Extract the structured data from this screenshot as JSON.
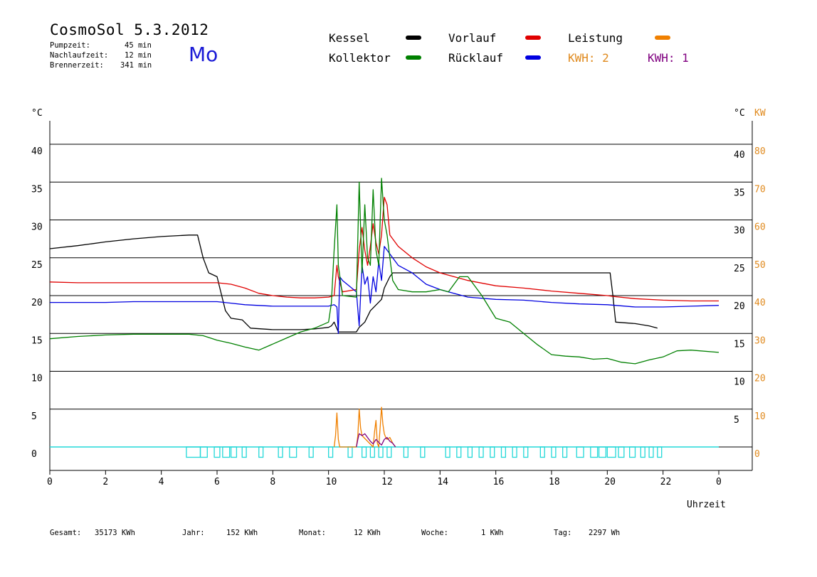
{
  "header": {
    "title": "CosmoSol 5.3.2012",
    "pumpzeit_label": "Pumpzeit:",
    "pumpzeit_value": "45 min",
    "nachlaufzeit_label": "Nachlaufzeit:",
    "nachlaufzeit_value": "12 min",
    "brennerzeit_label": "Brennerzeit:",
    "brennerzeit_value": "341 min",
    "weekday": "Mo"
  },
  "legend": {
    "kessel": {
      "label": "Kessel",
      "color": "#000000"
    },
    "kollektor": {
      "label": "Kollektor",
      "color": "#008000"
    },
    "vorlauf": {
      "label": "Vorlauf",
      "color": "#e00000"
    },
    "ruecklauf": {
      "label": "Rücklauf",
      "color": "#0000e0"
    },
    "leistung": {
      "label": "Leistung",
      "color": "#f08000"
    },
    "kwh2": {
      "label": "KWH: 2",
      "color": "#e08a1e"
    },
    "kwh1": {
      "label": "KWH: 1",
      "color": "#800080"
    }
  },
  "footer": {
    "gesamt_label": "Gesamt:",
    "gesamt_value": "35173 KWh",
    "jahr_label": "Jahr:",
    "jahr_value": "152 KWh",
    "monat_label": "Monat:",
    "monat_value": "12 KWh",
    "woche_label": "Woche:",
    "woche_value": "1 KWh",
    "tag_label": "Tag:",
    "tag_value": "2297 Wh"
  },
  "chart_data": {
    "type": "line",
    "xlabel": "Uhrzeit",
    "ylabel_left": "°C",
    "ylabel_right_1": "°C",
    "ylabel_right_2": "KW",
    "xlim": [
      0,
      24
    ],
    "ylim": [
      -3,
      43
    ],
    "x_ticks": [
      0,
      2,
      4,
      6,
      8,
      10,
      12,
      14,
      16,
      18,
      20,
      22,
      24
    ],
    "x_tick_labels": [
      "0",
      "2",
      "4",
      "6",
      "8",
      "10",
      "12",
      "14",
      "16",
      "18",
      "20",
      "22",
      "0"
    ],
    "y_ticks": [
      0,
      5,
      10,
      15,
      20,
      25,
      30,
      35,
      40
    ],
    "y_tick_labels_left": [
      "0",
      "5",
      "10",
      "15",
      "20",
      "25",
      "30",
      "35",
      "40"
    ],
    "y_tick_labels_right": [
      "",
      "5",
      "10",
      "15",
      "20",
      "25",
      "30",
      "35",
      "40"
    ],
    "kw_tick_labels": [
      "0",
      "10",
      "20",
      "30",
      "40",
      "50",
      "60",
      "70",
      "80"
    ],
    "grid": true,
    "series": [
      {
        "name": "Kessel",
        "color": "#000000",
        "x": [
          0,
          1,
          2,
          3,
          4,
          5,
          5.3,
          5.5,
          5.7,
          6.0,
          6.1,
          6.3,
          6.5,
          6.9,
          7.2,
          8,
          9,
          9.5,
          10,
          10.1,
          10.2,
          10.35,
          10.4,
          11.0,
          11.1,
          11.3,
          11.5,
          11.9,
          12.0,
          12.2,
          12.3,
          13,
          14,
          15,
          16,
          17,
          18,
          19,
          20.1,
          20.2,
          20.3,
          21,
          21.5,
          21.8
        ],
        "y": [
          26.2,
          26.6,
          27.1,
          27.5,
          27.8,
          28.0,
          28.0,
          25.0,
          23.0,
          22.5,
          21.0,
          18.0,
          17.0,
          16.8,
          15.7,
          15.5,
          15.5,
          15.6,
          15.8,
          16.0,
          16.5,
          15.2,
          15.2,
          15.2,
          15.8,
          16.5,
          18.0,
          19.5,
          21.0,
          22.5,
          23.0,
          23.0,
          23.0,
          23.0,
          23.0,
          23.0,
          23.0,
          23.0,
          23.0,
          20.0,
          16.5,
          16.3,
          16.0,
          15.7
        ]
      },
      {
        "name": "Vorlauf",
        "color": "#e00000",
        "x": [
          0,
          1,
          2,
          3,
          4,
          5,
          5.5,
          6.0,
          6.5,
          7.0,
          7.5,
          8.0,
          8.5,
          9.0,
          9.5,
          10.0,
          10.2,
          10.3,
          10.35,
          10.5,
          11.0,
          11.1,
          11.2,
          11.3,
          11.4,
          11.5,
          11.6,
          11.7,
          11.8,
          11.9,
          12.0,
          12.1,
          12.2,
          12.5,
          13.0,
          13.5,
          14,
          15,
          16,
          17,
          18,
          19,
          20,
          20.2,
          21,
          22,
          23,
          24
        ],
        "y": [
          21.8,
          21.7,
          21.7,
          21.7,
          21.7,
          21.7,
          21.7,
          21.7,
          21.5,
          21.0,
          20.3,
          20.0,
          19.8,
          19.7,
          19.7,
          19.8,
          20.0,
          24.0,
          22.5,
          20.5,
          20.8,
          26.0,
          29.0,
          26.0,
          24.0,
          26.5,
          29.5,
          27.0,
          25.5,
          28.0,
          33.0,
          32.0,
          28.0,
          26.5,
          25.0,
          23.8,
          23.0,
          22.0,
          21.3,
          21.0,
          20.6,
          20.3,
          20.0,
          19.9,
          19.6,
          19.4,
          19.3,
          19.3
        ]
      },
      {
        "name": "Rücklauf",
        "color": "#0000e0",
        "x": [
          0,
          1,
          2,
          3,
          4,
          5,
          5.5,
          6.0,
          6.5,
          7.0,
          8.0,
          9.0,
          10.0,
          10.2,
          10.3,
          10.35,
          10.4,
          10.5,
          11.0,
          11.1,
          11.2,
          11.3,
          11.4,
          11.5,
          11.6,
          11.7,
          11.8,
          11.9,
          12.0,
          12.2,
          12.5,
          13.0,
          13.5,
          14,
          15,
          16,
          17,
          18,
          19,
          20,
          21,
          22,
          23,
          24
        ],
        "y": [
          19.1,
          19.1,
          19.1,
          19.2,
          19.2,
          19.2,
          19.2,
          19.2,
          19.0,
          18.8,
          18.6,
          18.6,
          18.6,
          18.8,
          18.5,
          15.0,
          22.5,
          22.0,
          20.5,
          16.0,
          24.0,
          21.5,
          22.5,
          19.0,
          22.5,
          20.5,
          24.5,
          22.0,
          26.5,
          25.5,
          24.0,
          23.0,
          21.5,
          20.8,
          19.8,
          19.5,
          19.4,
          19.1,
          18.9,
          18.8,
          18.5,
          18.5,
          18.6,
          18.7
        ]
      },
      {
        "name": "Kollektor",
        "color": "#008000",
        "x": [
          0,
          1,
          2,
          3,
          4,
          5,
          5.5,
          6.0,
          6.5,
          7.0,
          7.5,
          8.0,
          8.5,
          9.0,
          9.5,
          10.0,
          10.1,
          10.2,
          10.3,
          10.35,
          10.5,
          11.0,
          11.1,
          11.2,
          11.3,
          11.4,
          11.5,
          11.6,
          11.7,
          11.8,
          11.9,
          12.0,
          12.1,
          12.3,
          12.5,
          13.0,
          13.5,
          14.0,
          14.3,
          14.7,
          15.0,
          15.5,
          16.0,
          16.5,
          17.0,
          17.5,
          18.0,
          18.5,
          19,
          19.5,
          20,
          20.5,
          21,
          21.5,
          22,
          22.5,
          23,
          24
        ],
        "y": [
          14.3,
          14.6,
          14.8,
          14.9,
          14.9,
          14.9,
          14.7,
          14.1,
          13.7,
          13.2,
          12.8,
          13.6,
          14.4,
          15.2,
          15.7,
          16.5,
          19.0,
          26.0,
          32.0,
          24.0,
          20.0,
          19.8,
          35.0,
          23.0,
          32.0,
          25.0,
          24.0,
          34.0,
          26.0,
          24.0,
          35.5,
          30.0,
          28.0,
          22.0,
          20.8,
          20.5,
          20.5,
          20.8,
          20.5,
          22.5,
          22.5,
          20.0,
          17.0,
          16.5,
          15.0,
          13.5,
          12.2,
          12.0,
          11.9,
          11.6,
          11.7,
          11.2,
          11.0,
          11.5,
          11.9,
          12.7,
          12.8,
          12.5
        ]
      },
      {
        "name": "Leistung",
        "color": "#f08000",
        "axis": "kw",
        "x": [
          10.2,
          10.25,
          10.3,
          10.35,
          10.4,
          11.0,
          11.05,
          11.1,
          11.15,
          11.2,
          11.6,
          11.65,
          11.7,
          11.75,
          11.8,
          11.85,
          11.9,
          11.95,
          12.0,
          12.05,
          12.1,
          12.2,
          12.3,
          12.4
        ],
        "y": [
          0,
          3,
          9,
          2,
          0,
          0,
          3,
          10,
          5,
          3,
          0,
          4,
          7,
          1,
          0,
          5,
          10.5,
          6,
          3.5,
          2.5,
          2.0,
          2.5,
          1.0,
          0
        ]
      },
      {
        "name": "Leistung (KWH 1)",
        "color": "#800080",
        "axis": "kw",
        "x": [
          11.0,
          11.05,
          11.1,
          11.2,
          11.3,
          11.4,
          11.5,
          11.6,
          11.7,
          11.8,
          11.9,
          12.0,
          12.1,
          12.2,
          12.3,
          12.4
        ],
        "y": [
          0,
          2,
          3.5,
          3.0,
          3.5,
          2.5,
          1.5,
          0.8,
          2.0,
          1.2,
          0.5,
          2.0,
          2.5,
          1.5,
          1.0,
          0
        ]
      }
    ],
    "pump_pulses": {
      "color": "#22d8d8",
      "x_start": [
        4.9,
        5.4,
        5.9,
        6.2,
        6.5,
        6.9,
        7.5,
        8.2,
        8.6,
        9.3,
        10.0,
        10.7,
        11.2,
        11.5,
        11.8,
        12.1,
        12.7,
        13.3,
        14.2,
        14.6,
        15.0,
        15.4,
        15.8,
        16.2,
        16.6,
        17.0,
        17.6,
        18.0,
        18.4,
        18.9,
        19.4,
        19.7,
        20.0,
        20.4,
        20.8,
        21.2,
        21.5,
        21.8
      ],
      "x_end": [
        5.4,
        5.65,
        6.1,
        6.45,
        6.7,
        7.05,
        7.65,
        8.35,
        8.85,
        9.45,
        10.15,
        10.85,
        11.35,
        11.65,
        11.95,
        12.25,
        12.85,
        13.45,
        14.35,
        14.75,
        15.15,
        15.55,
        15.95,
        16.35,
        16.75,
        17.15,
        17.75,
        18.15,
        18.55,
        19.15,
        19.65,
        19.95,
        20.3,
        20.6,
        21.0,
        21.35,
        21.65,
        21.95
      ],
      "height": 0.22
    }
  }
}
